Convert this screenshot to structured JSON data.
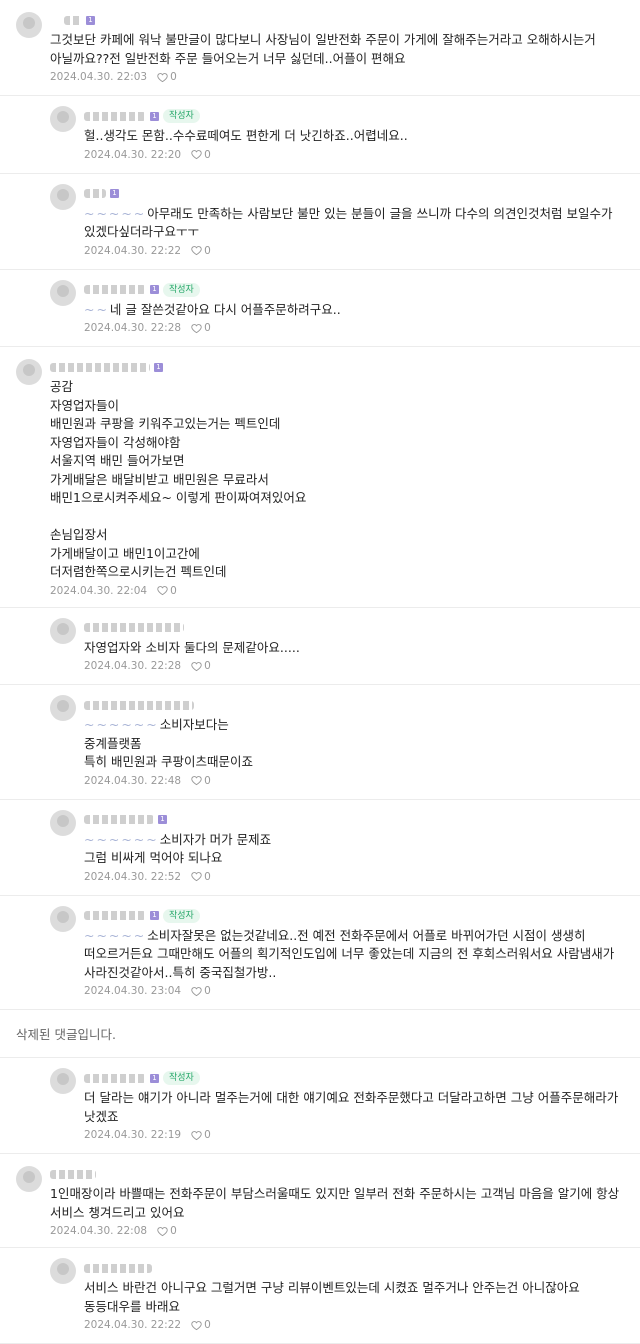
{
  "comments": [
    {
      "body": "그것보단 카페에 워낙 불만글이 많다보니 사장님이 일반전화 주문이 가게에 잘해주는거라고 오해하시는거 아닐까요??전 일반전화 주문 들어오는거 너무 싫던데..어플이 편해요",
      "date": "2024.04.30. 22:03",
      "likes": "0",
      "replies": [
        {
          "body": "헐..생각도 몬함..수수료떼여도 편한게 더 낫긴하죠..어렵네요..",
          "date": "2024.04.30. 22:20",
          "likes": "0",
          "author_badge": "작성자"
        },
        {
          "body": "아무래도 만족하는 사람보단 불만 있는 분들이 글을 쓰니까 다수의 의견인것처럼 보일수가 있겠다싶더라구요ㅜㅜ",
          "date": "2024.04.30. 22:22",
          "likes": "0"
        },
        {
          "body": "네 글 잘쓴것같아요 다시 어플주문하려구요..",
          "date": "2024.04.30. 22:28",
          "likes": "0",
          "author_badge": "작성자"
        }
      ]
    },
    {
      "body": "공감\n자영업자들이\n배민원과 쿠팡을 키워주고있는거는 펙트인데\n자영업자들이 각성해야함\n서울지역 배민 들어가보면\n가게배달은 배달비받고 배민원은 무료라서\n배민1으로시켜주세요~ 이렇게 판이짜여져있어요\n\n손님입장서\n가게배달이고 배민1이고간에\n더저렴한쪽으로시키는건 펙트인데",
      "date": "2024.04.30. 22:04",
      "likes": "0",
      "replies": [
        {
          "body": "자영업자와 소비자 둘다의 문제같아요.....",
          "date": "2024.04.30. 22:28",
          "likes": "0"
        },
        {
          "body": "소비자보다는\n중계플랫폼\n특히 배민원과 쿠팡이츠때문이죠",
          "date": "2024.04.30. 22:48",
          "likes": "0"
        },
        {
          "body": "소비자가 머가 문제죠\n그럼 비싸게 먹어야 되나요",
          "date": "2024.04.30. 22:52",
          "likes": "0"
        },
        {
          "body": "소비자잘못은 없는것같네요..전 예전 전화주문에서 어플로 바뀌어가던 시점이 생생히 떠오르거든요 그때만해도 어플의 획기적인도입에 너무 좋았는데 지금의 전 후회스러워서요 사람냄새가 사라진것같아서..특히 중국집철가방..",
          "date": "2024.04.30. 23:04",
          "likes": "0",
          "author_badge": "작성자"
        }
      ]
    }
  ],
  "deleted_notice": "삭제된 댓글입니다.",
  "deleted_reply": {
    "body": "더 달라는 얘기가 아니라 멀주는거에 대한 얘기예요 전화주문했다고 더달라고하면 그냥 어플주문해라가 낫겠죠",
    "date": "2024.04.30. 22:19",
    "likes": "0",
    "author_badge": "작성자"
  },
  "comment3": {
    "body": "1인매장이라 바쁠때는 전화주문이 부담스러울때도 있지만 일부러 전화 주문하시는 고객님 마음을 알기에 항상 서비스 챙겨드리고 있어요",
    "date": "2024.04.30. 22:08",
    "likes": "0",
    "reply": {
      "body": "서비스 바란건 아니구요 그럴거면 구냥 리뷰이벤트있는데 시켰죠 멀주거나 안주는건 아니잖아요 동등대우를 바래요",
      "date": "2024.04.30. 22:22",
      "likes": "0"
    }
  },
  "level_badge": "1",
  "colors": {
    "author_badge": "#27a86a",
    "meta": "#999999",
    "level": "#9c8ed8"
  }
}
